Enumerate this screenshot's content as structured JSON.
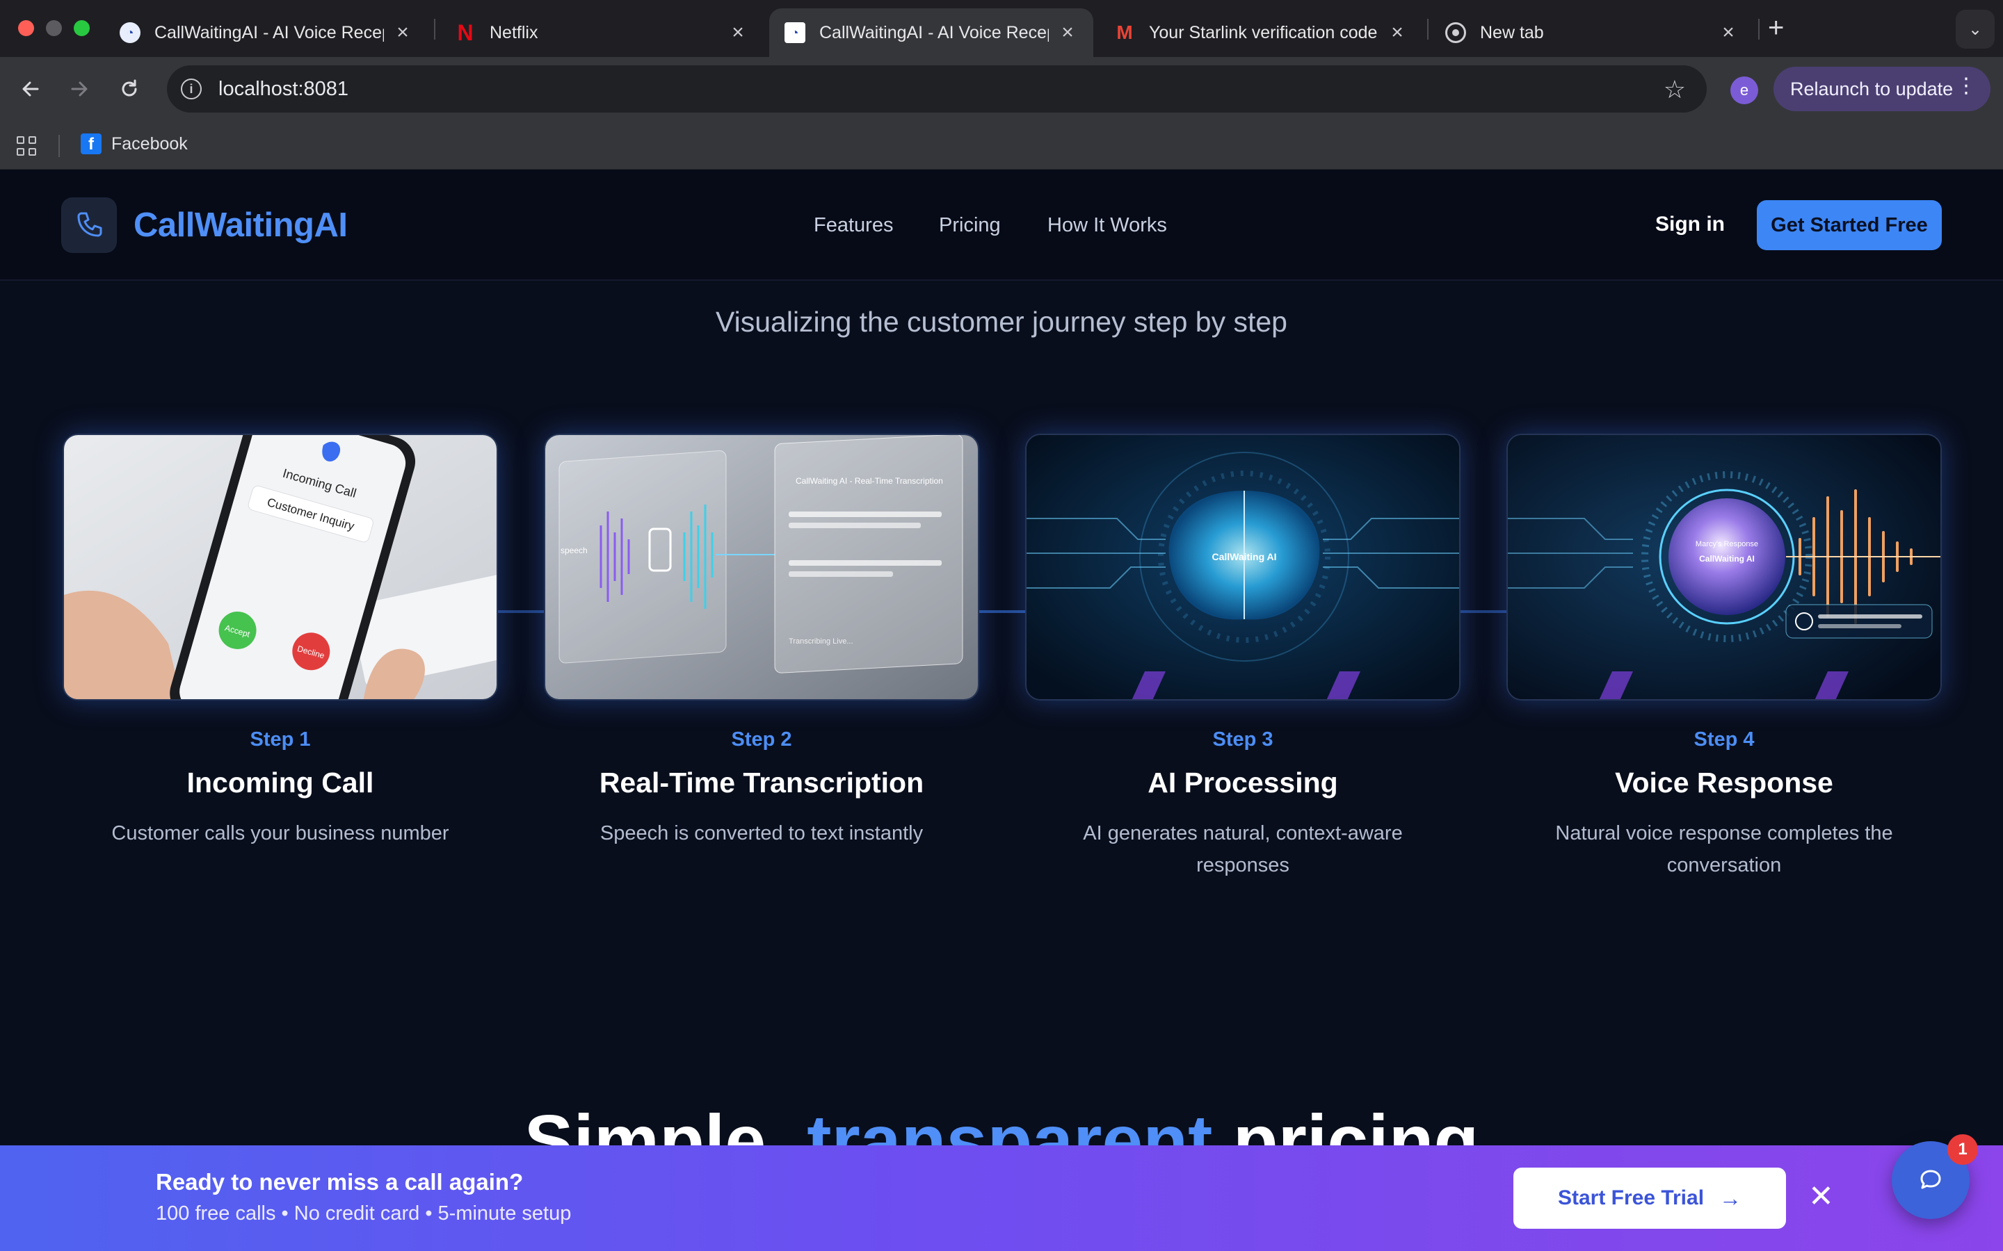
{
  "browser": {
    "tabs": [
      {
        "title": "CallWaitingAI - AI Voice Recep",
        "active": false
      },
      {
        "title": "Netflix",
        "active": false
      },
      {
        "title": "CallWaitingAI - AI Voice Recep",
        "active": true
      },
      {
        "title": "Your Starlink verification code",
        "active": false
      },
      {
        "title": "New tab",
        "active": false
      }
    ],
    "url": "localhost:8081",
    "profile_initial": "e",
    "relaunch_label": "Relaunch to update",
    "bookmarks": [
      {
        "label": "Facebook"
      }
    ]
  },
  "site": {
    "brand": "CallWaitingAI",
    "nav": [
      "Features",
      "Pricing",
      "How It Works"
    ],
    "sign_in": "Sign in",
    "cta": "Get Started Free",
    "accent": "#4f8ff7"
  },
  "journey": {
    "subtitle": "Visualizing the customer journey step by step",
    "steps": [
      {
        "label": "Step 1",
        "title": "Incoming Call",
        "desc": "Customer calls your business number"
      },
      {
        "label": "Step 2",
        "title": "Real-Time Transcription",
        "desc": "Speech is converted to text instantly"
      },
      {
        "label": "Step 3",
        "title": "AI Processing",
        "desc": "AI generates natural, context-aware responses"
      },
      {
        "label": "Step 4",
        "title": "Voice Response",
        "desc": "Natural voice response completes the conversation"
      }
    ],
    "image_text": {
      "incoming_call": "Incoming Call",
      "customer_inquiry": "Customer Inquiry",
      "accept": "Accept",
      "decline": "Decline",
      "speech": "speech",
      "transcription_title": "CallWaiting AI - Real-Time Transcription",
      "transcribing": "Transcribing Live...",
      "ai_brand": "CallWaiting AI",
      "marcys_response": "Marcy's Response"
    }
  },
  "pricing": {
    "heading_start": "Simple, ",
    "heading_highlight": "transparent",
    "heading_end": " pricing"
  },
  "banner": {
    "title": "Ready to never miss a call again?",
    "subtitle": "100 free calls • No credit card • 5-minute setup",
    "button": "Start Free Trial",
    "chat_badge": "1"
  }
}
